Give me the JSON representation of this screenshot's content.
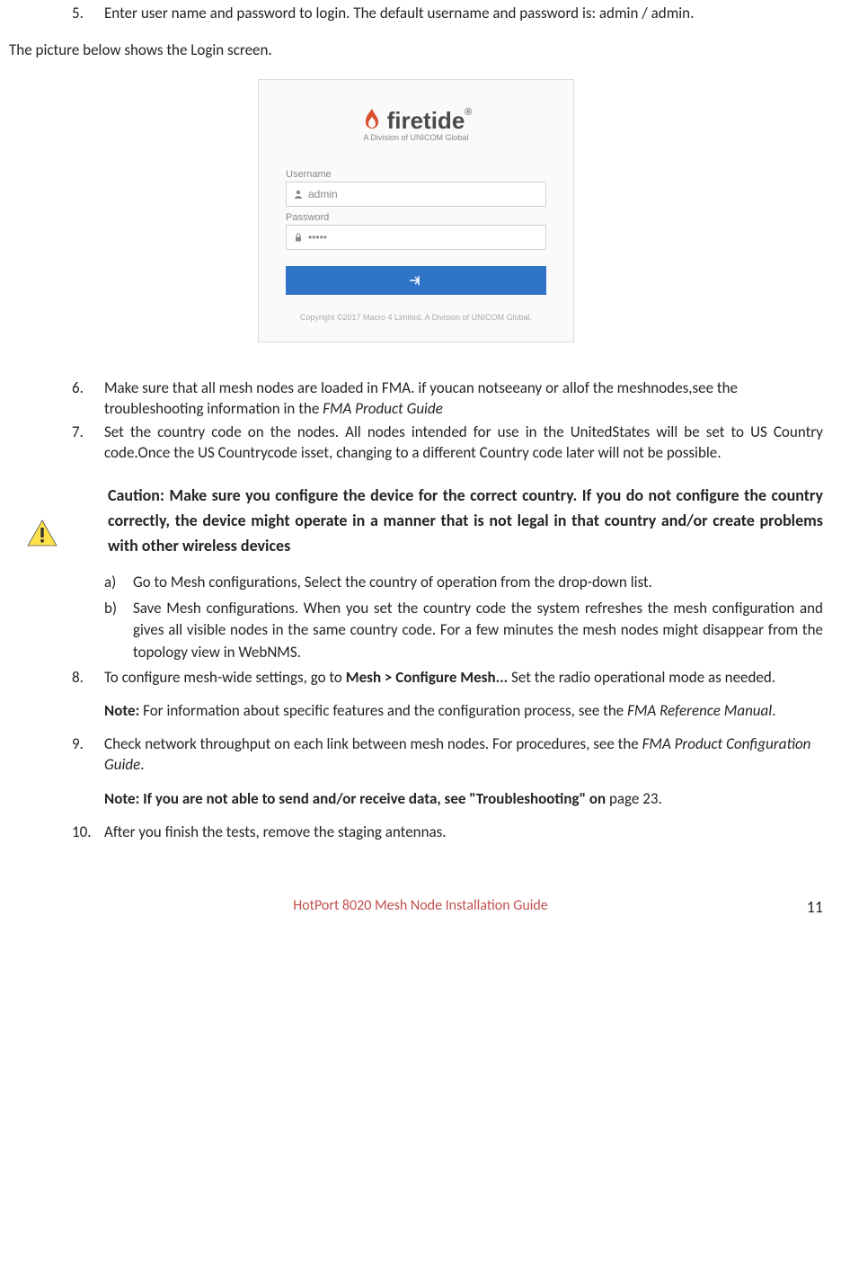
{
  "item5": {
    "num": "5.",
    "text": "Enter user name and password to login. The default username and password is: admin / admin."
  },
  "sentence1": "The   picture below   shows   the Login screen.",
  "login_screen": {
    "brand_main": "firetide",
    "brand_reg": "®",
    "brand_sub": "A Division of UNICOM Global",
    "username_label": "Username",
    "username_value": "admin",
    "password_label": "Password",
    "password_value": "•••••",
    "copyright": "Copyright ©2017 Macro 4 Limited. A Division of UNICOM Global."
  },
  "item6": {
    "num": "6.",
    "a": "Make  sure  that all  mesh nodes  are loaded  in  FMA. if youcan notseeany or  allof the meshnodes,see the troubleshooting information in the ",
    "b": "FMA Product Guide"
  },
  "item7": {
    "num": "7.",
    "text": "Set the  country code  on the nodes. All nodes intended  for use  in  the UnitedStates will be set to US  Country code.Once   the   US   Countrycode  isset,  changing  to  a  different Country code  later will not be possible."
  },
  "caution": "Caution: Make sure you configure the device for the correct country. If you do not configure the country correctly, the device might operate in a manner that is not legal in that country and/or create problems with other wireless devices",
  "sub_a": {
    "num": "a)",
    "text": "Go to Mesh configurations, Select  the country of operation from the drop-down list."
  },
  "sub_b": {
    "num": "b)",
    "text": "Save Mesh configurations. When  you  set the  country  code  the  system  refreshes  the mesh  configuration and  gives all visible nodes in  the same country code. For a few minutes the  mesh nodes might  disappear  from  the topology view in WebNMS."
  },
  "item8": {
    "num": "8.",
    "a": "To  configure mesh-wide settings, go to ",
    "b": "Mesh > Configure Mesh...",
    "c": " Set the radio operational mode as needed."
  },
  "note1": {
    "a": "Note:",
    "b": " For  information about specific features and the  configuration process, see  the  ",
    "c": "FMA Reference Manual",
    "d": "."
  },
  "item9": {
    "num": "9.",
    "a": "Check network throughput on each link between  mesh  nodes.  For procedures, see the ",
    "b": "FMA Product Configuration Guide",
    "c": "."
  },
  "note2": {
    "a": "Note: If you are not able to send and/or receive data, see \"Troubleshooting\" on",
    "b": " page 23."
  },
  "item10": {
    "num": "10.",
    "text": "After you finish the tests, remove   the staging antennas."
  },
  "footer": {
    "title": "HotPort 8020 Mesh Node Installation Guide",
    "page": "11"
  }
}
